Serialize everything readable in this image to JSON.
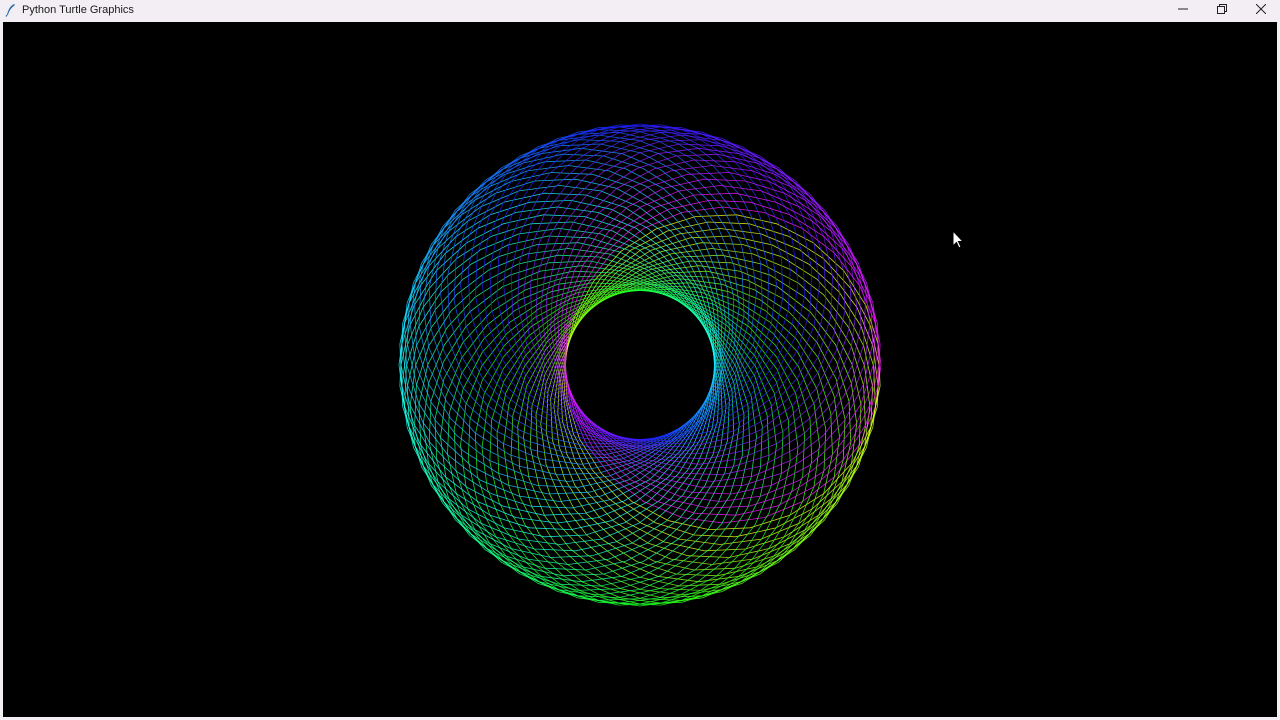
{
  "window": {
    "title": "Python Turtle Graphics",
    "app_icon": "feather-icon",
    "controls": {
      "minimize_icon": "minimize-icon",
      "restore_icon": "restore-icon",
      "close_icon": "close-icon"
    }
  },
  "canvas": {
    "background": "#000000"
  },
  "drawing": {
    "shape": "rainbow spirograph torus",
    "colors": [
      "#ff00ff",
      "#8000ff",
      "#0000ff",
      "#00ffff",
      "#00ff00",
      "#ffff00"
    ]
  },
  "cursor": {
    "icon": "mouse-pointer-icon"
  }
}
